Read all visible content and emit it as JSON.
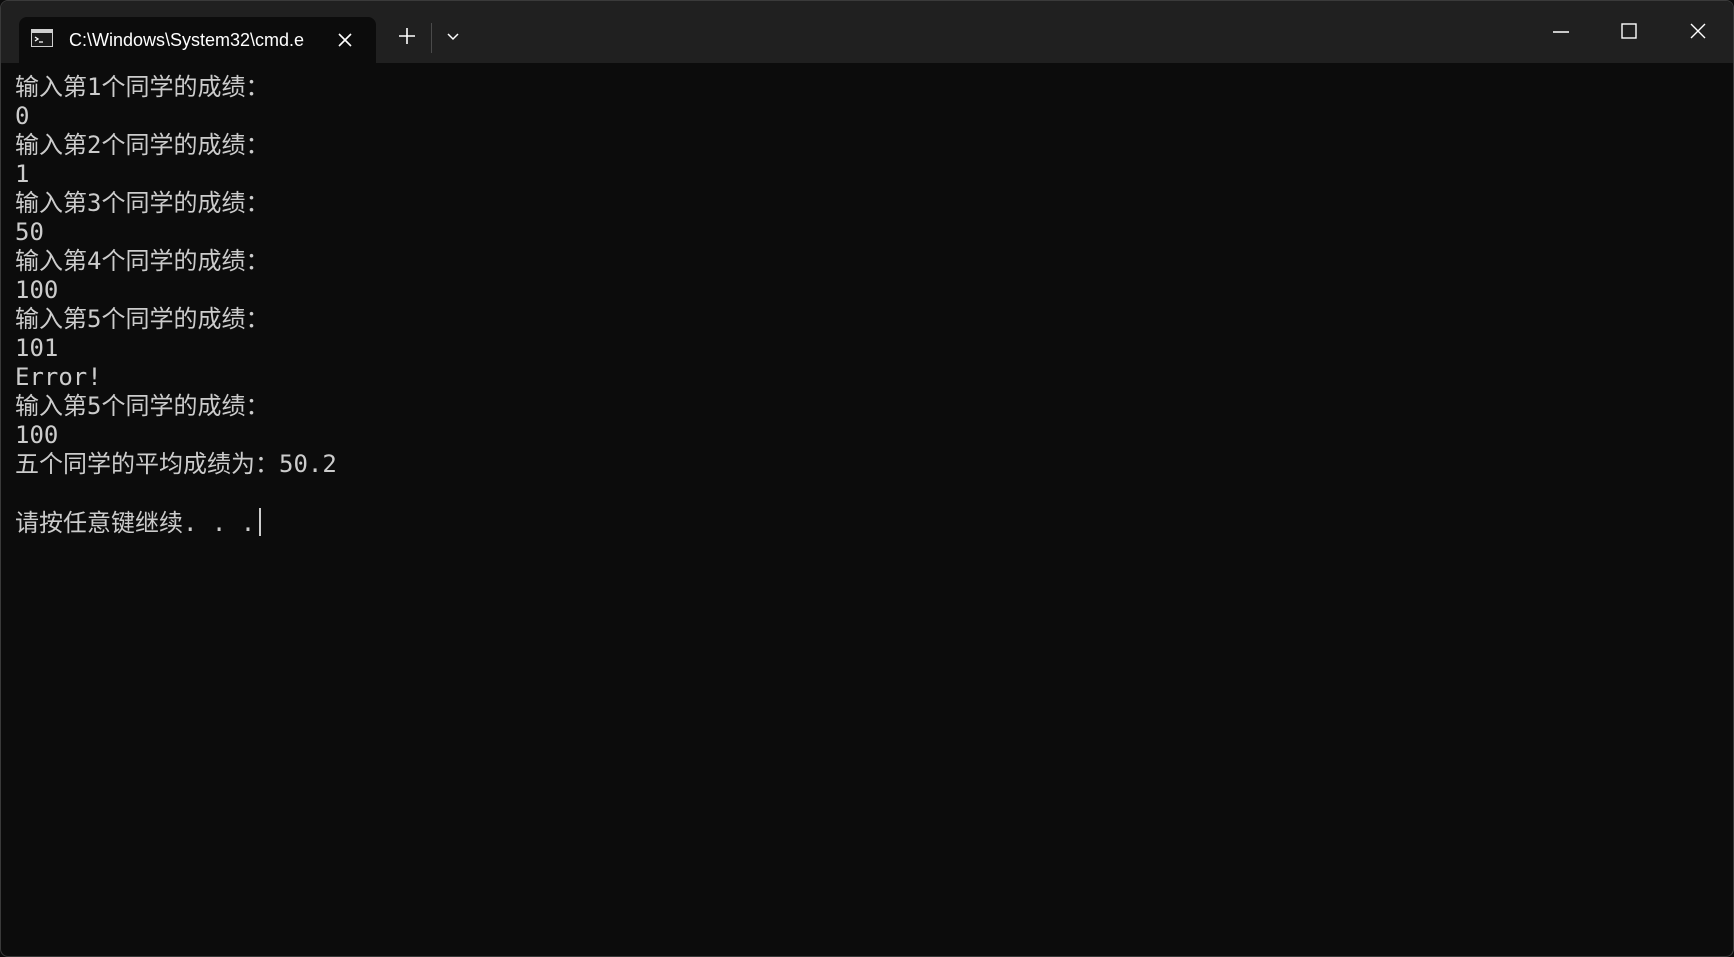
{
  "window": {
    "tab_title": "C:\\Windows\\System32\\cmd.e"
  },
  "titlebar": {
    "icons": {
      "tab_icon": "terminal-icon",
      "tab_close": "close-icon",
      "new_tab": "plus-icon",
      "dropdown": "chevron-down-icon",
      "minimize": "minimize-icon",
      "maximize": "maximize-icon",
      "close": "close-icon"
    }
  },
  "console": {
    "lines": [
      "输入第1个同学的成绩：",
      "0",
      "输入第2个同学的成绩：",
      "1",
      "输入第3个同学的成绩：",
      "50",
      "输入第4个同学的成绩：",
      "100",
      "输入第5个同学的成绩：",
      "101",
      "Error!",
      "输入第5个同学的成绩：",
      "100",
      "五个同学的平均成绩为：50.2",
      "",
      "请按任意键继续. . ."
    ]
  },
  "colors": {
    "background": "#0c0c0c",
    "titlebar": "#202020",
    "text": "#cccccc"
  }
}
